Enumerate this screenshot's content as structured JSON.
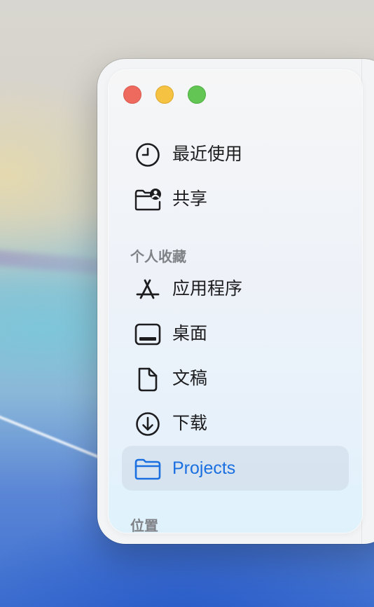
{
  "sidebar": {
    "top_items": [
      {
        "label": "最近使用",
        "icon": "clock-icon"
      },
      {
        "label": "共享",
        "icon": "shared-folder-icon"
      }
    ],
    "favorites_header": "个人收藏",
    "favorites": [
      {
        "label": "应用程序",
        "icon": "app-store-icon"
      },
      {
        "label": "桌面",
        "icon": "desktop-icon"
      },
      {
        "label": "文稿",
        "icon": "document-icon"
      },
      {
        "label": "下载",
        "icon": "download-icon"
      },
      {
        "label": "Projects",
        "icon": "folder-icon",
        "selected": true
      }
    ],
    "locations_header": "位置"
  },
  "colors": {
    "accent": "#1b6fe0",
    "close": "#ee6a5f",
    "minimize": "#f5c242",
    "zoom": "#62c554"
  }
}
